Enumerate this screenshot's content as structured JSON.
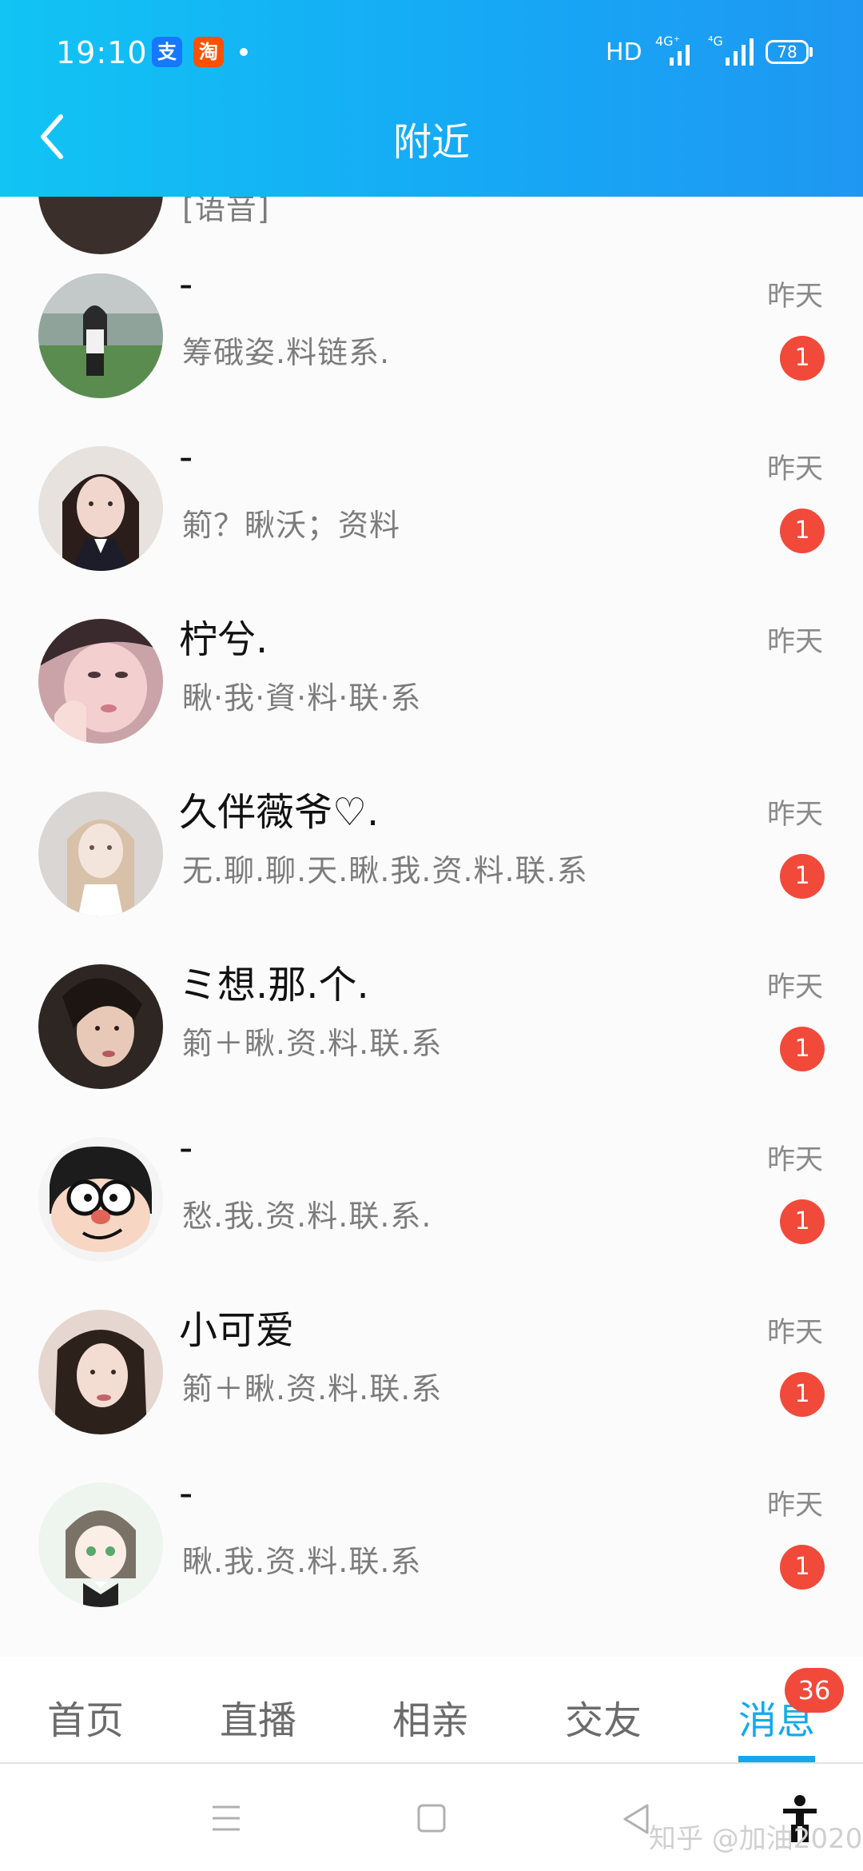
{
  "status_bar": {
    "time": "19:10",
    "app_icons": [
      "支",
      "淘"
    ],
    "network": "HD",
    "signal_1": "4G⁺",
    "signal_2": "⁴G",
    "battery": "78"
  },
  "header": {
    "title": "附近"
  },
  "contacts": [
    {
      "name": "",
      "preview": "[语音]",
      "time": ""
    },
    {
      "name": "-",
      "preview": "筹硪姿.料链系.",
      "time": "昨天",
      "unread": "1"
    },
    {
      "name": "-",
      "preview": "箣？瞅沃；资料",
      "time": "昨天",
      "unread": "1"
    },
    {
      "name": "柠兮.",
      "preview": "瞅·我·資·料·联·系",
      "time": "昨天",
      "unread": ""
    },
    {
      "name": "久伴薇爷♡.",
      "preview": "无.聊.聊.天.瞅.我.资.料.联.系",
      "time": "昨天",
      "unread": "1"
    },
    {
      "name": "ミ想.那.个.",
      "preview": "箣＋瞅.资.料.联.系",
      "time": "昨天",
      "unread": "1"
    },
    {
      "name": "-",
      "preview": "愁.我.资.料.联.系.",
      "time": "昨天",
      "unread": "1"
    },
    {
      "name": "小可爱",
      "preview": "箣＋瞅.资.料.联.系",
      "time": "昨天",
      "unread": "1"
    },
    {
      "name": "-",
      "preview": "瞅.我.资.料.联.系",
      "time": "昨天",
      "unread": "1"
    }
  ],
  "tabs": [
    "首页",
    "直播",
    "相亲",
    "交友",
    "消息"
  ],
  "active_tab": "消息",
  "messages_badge": "36",
  "watermark": "知乎 @加油2020",
  "colors": {
    "accent": "#15a9ec",
    "badge": "#f14a3a",
    "header": "#16a9f5"
  }
}
